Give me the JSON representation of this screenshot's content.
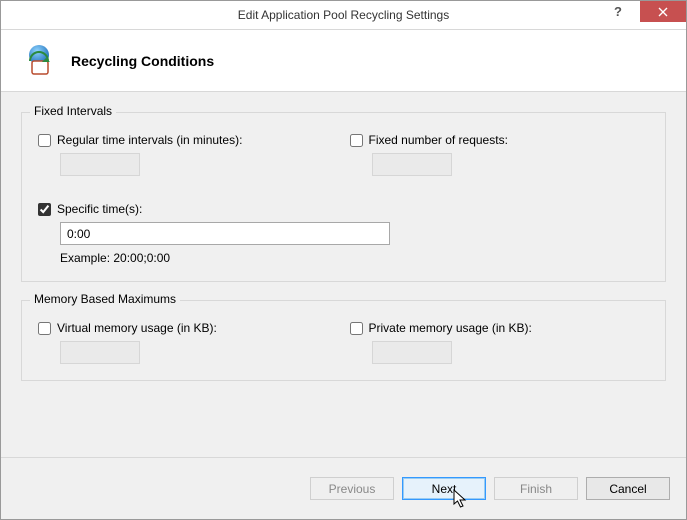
{
  "window": {
    "title": "Edit Application Pool Recycling Settings"
  },
  "header": {
    "title": "Recycling Conditions"
  },
  "groups": {
    "fixed": {
      "legend": "Fixed Intervals",
      "regular_label": "Regular time intervals (in minutes):",
      "fixed_requests_label": "Fixed number of requests:",
      "specific_label": "Specific time(s):",
      "specific_value": "0:00",
      "example_label": "Example: 20:00;0:00"
    },
    "memory": {
      "legend": "Memory Based Maximums",
      "virtual_label": "Virtual memory usage (in KB):",
      "private_label": "Private memory usage (in KB):"
    }
  },
  "buttons": {
    "previous": "Previous",
    "next": "Next",
    "finish": "Finish",
    "cancel": "Cancel"
  },
  "state": {
    "regular_checked": false,
    "fixed_requests_checked": false,
    "specific_checked": true,
    "virtual_checked": false,
    "private_checked": false
  }
}
